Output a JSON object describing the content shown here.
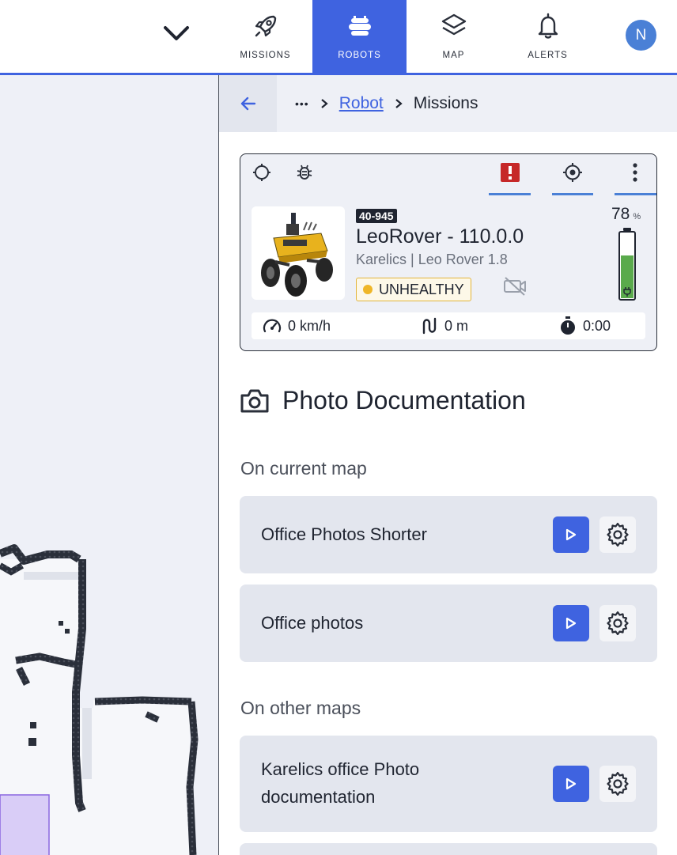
{
  "nav": {
    "items": [
      {
        "label": "MISSIONS",
        "icon": "rocket-icon"
      },
      {
        "label": "ROBOTS",
        "icon": "robot-icon"
      },
      {
        "label": "MAP",
        "icon": "layers-icon"
      },
      {
        "label": "ALERTS",
        "icon": "bell-icon"
      }
    ],
    "active": "ROBOTS",
    "avatar_initial": "N"
  },
  "breadcrumb": {
    "ellipsis": "•••",
    "robot_link": "Robot",
    "current": "Missions"
  },
  "robot": {
    "tag": "40-945",
    "name": "LeoRover - 110.0.0",
    "model": "Karelics | Leo Rover 1.8",
    "health": "UNHEALTHY",
    "battery_percent": "78",
    "battery_unit": "%",
    "speed": "0 km/h",
    "distance": "0 m",
    "duration": "0:00"
  },
  "section": {
    "title": "Photo Documentation",
    "current_map_heading": "On current map",
    "other_maps_heading": "On other maps"
  },
  "missions_current": [
    {
      "name": "Office Photos Shorter"
    },
    {
      "name": "Office photos"
    }
  ],
  "missions_other": [
    {
      "name_line1": "Karelics office Photo",
      "name_line2": "documentation"
    }
  ],
  "colors": {
    "accent": "#3f63e0",
    "warning": "#efb627",
    "alert": "#c62828",
    "battery": "#5aaa4c"
  }
}
